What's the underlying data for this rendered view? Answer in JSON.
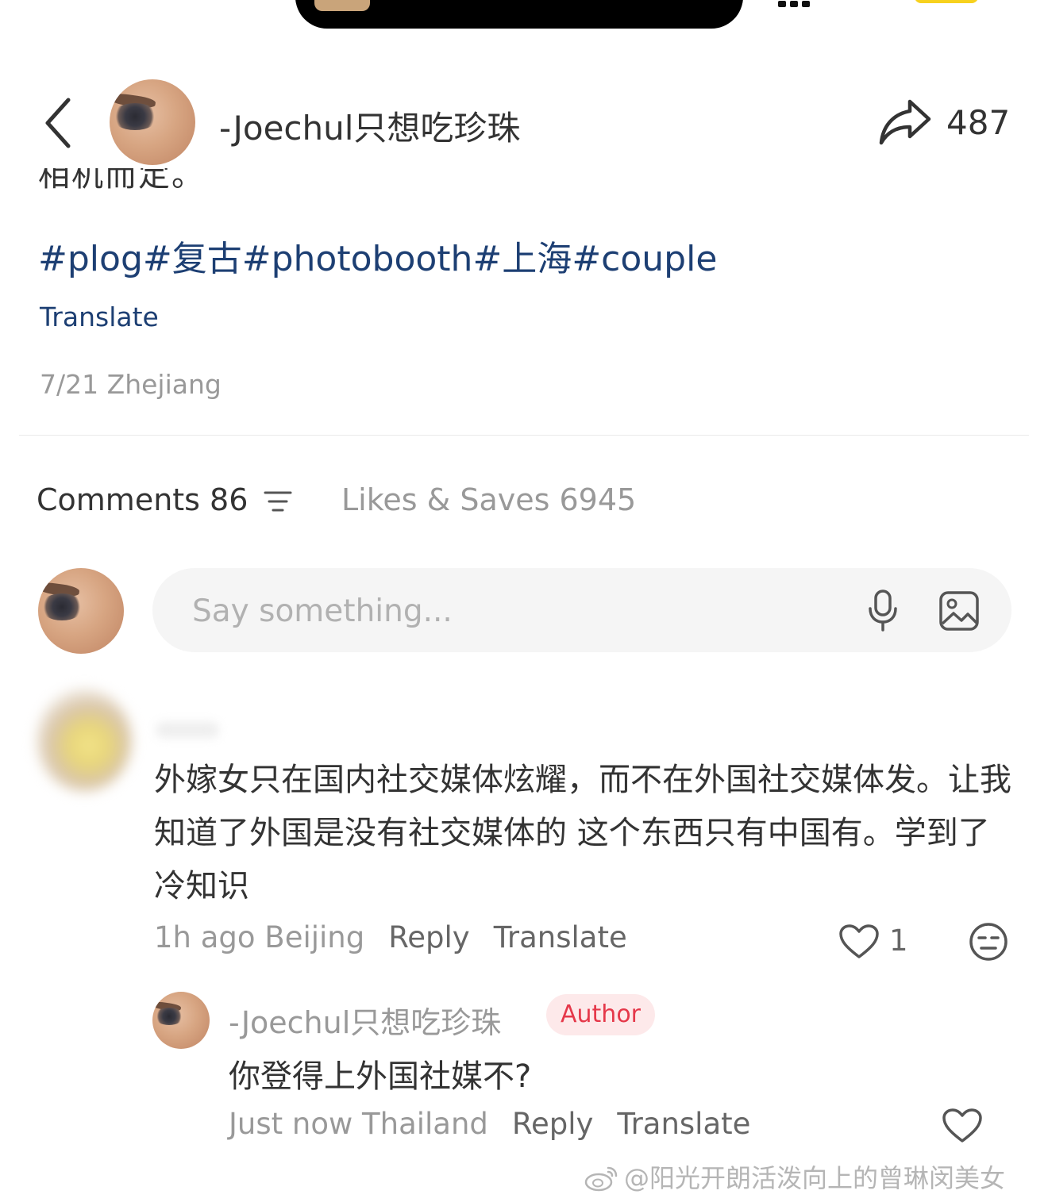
{
  "header": {
    "username": "-Joechul只想吃珍珠",
    "share_count": "487"
  },
  "post": {
    "cut_text": "相机而定。",
    "hashtags": [
      "#plog",
      "#复古",
      "#photobooth",
      "#上海",
      "#couple"
    ],
    "translate_label": "Translate",
    "date_location": "7/21 Zhejiang"
  },
  "tabs": {
    "comments_label": "Comments 86",
    "likes_label": "Likes & Saves 6945"
  },
  "comment_input": {
    "placeholder": "Say something..."
  },
  "comments": [
    {
      "text": "外嫁女只在国内社交媒体炫耀，而不在外国社交媒体发。让我知道了外国是没有社交媒体的 这个东西只有中国有。学到了冷知识",
      "time_location": "1h ago Beijing",
      "reply_label": "Reply",
      "translate_label": "Translate",
      "like_count": "1",
      "replies": [
        {
          "username": "-Joechul只想吃珍珠",
          "badge": "Author",
          "text": "你登得上外国社媒不?",
          "time_location": "Just now Thailand",
          "reply_label": "Reply",
          "translate_label": "Translate"
        }
      ]
    }
  ],
  "watermark": "@阳光开朗活泼向上的曾琳闵美女",
  "colors": {
    "hashtag": "#1d3f73",
    "muted": "#999999",
    "author_badge_text": "#e5384a",
    "author_badge_bg": "#fde9ea",
    "input_bg": "#f5f5f5"
  }
}
